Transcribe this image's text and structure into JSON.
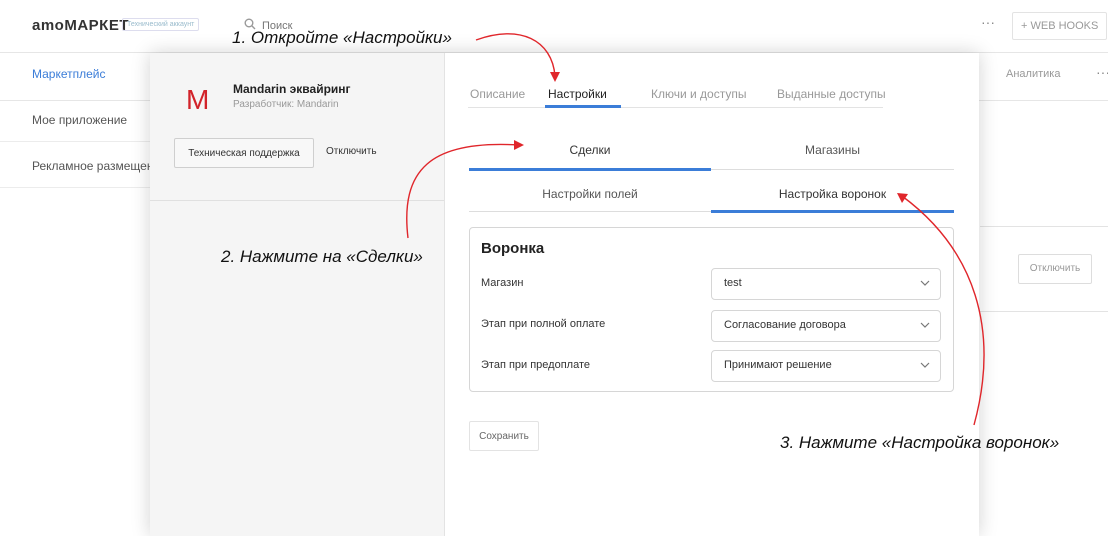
{
  "header": {
    "logo": "amoМАРКЕТ",
    "badge": "Технический аккаунт",
    "search_placeholder": "Поиск",
    "more": "···",
    "webhooks": "+ WEB HOOKS"
  },
  "nav": {
    "marketplace": "Маркетплейс",
    "analytics": "Аналитика",
    "more": "···"
  },
  "sidebar": {
    "items": [
      {
        "label": "Мое приложение"
      },
      {
        "label": "Рекламное размещение"
      }
    ]
  },
  "background_card": {
    "disable": "Отключить"
  },
  "modal": {
    "app": {
      "logo_letter": "M",
      "name": "Mandarin эквайринг",
      "developer": "Разработчик: Mandarin"
    },
    "support_button": "Техническая поддержка",
    "disable_button": "Отключить",
    "tabs": [
      {
        "label": "Описание"
      },
      {
        "label": "Настройки"
      },
      {
        "label": "Ключи и доступы"
      },
      {
        "label": "Выданные доступы"
      }
    ],
    "section_tabs": [
      {
        "label": "Сделки"
      },
      {
        "label": "Магазины"
      }
    ],
    "sub_tabs": [
      {
        "label": "Настройки полей"
      },
      {
        "label": "Настройка воронок"
      }
    ],
    "panel": {
      "title": "Воронка",
      "rows": [
        {
          "label": "Магазин",
          "value": "test"
        },
        {
          "label": "Этап при полной оплате",
          "value": "Согласование договора"
        },
        {
          "label": "Этап при предоплате",
          "value": "Принимают решение"
        }
      ]
    },
    "save_button": "Сохранить"
  },
  "annotations": [
    {
      "text": "1. Откройте «Настройки»"
    },
    {
      "text": "2. Нажмите на «Сделки»"
    },
    {
      "text": "3. Нажмите «Настройка воронок»"
    }
  ],
  "colors": {
    "accent": "#3b7dd8",
    "arrow": "#e0262b",
    "brand_logo": "#d2232a"
  }
}
